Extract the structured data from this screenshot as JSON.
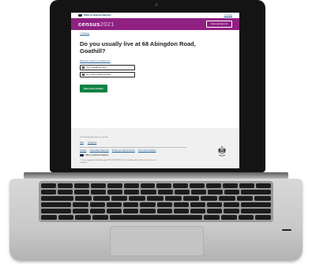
{
  "topbar": {
    "ons_label": "Office for National Statistics",
    "cymraeg_label": "Cymraeg"
  },
  "masthead": {
    "logo_word": "census",
    "logo_year": "2021",
    "save_label": "Save and sign out"
  },
  "content": {
    "previous_label": "< Previous",
    "question": "Do you usually live at 68 Abingdon Road, Goathill?",
    "what_mean_label": "What we mean by \"usually live\"",
    "options": [
      "Yes, I usually live here",
      "No, I don't usually live here"
    ],
    "continue_label": "Save and continue"
  },
  "footer": {
    "intro": "The following links open in a new tab",
    "links": [
      "Help",
      "Contact us"
    ],
    "links2": [
      "Cookies",
      "Accessibility statement",
      "Privacy and data protection",
      "Terms and conditions"
    ],
    "ons_label": "Office for National Statistics",
    "copyright": "© Crown copyright and database rights 2020 OS 100019153. Use of address data is subject to the terms and conditions."
  },
  "colors": {
    "census_purple": "#902082",
    "continue_green": "#0f8243",
    "link_blue": "#206095"
  },
  "icons": [
    "ons-logo-icon",
    "royal-crest-icon",
    "radio-icon"
  ]
}
